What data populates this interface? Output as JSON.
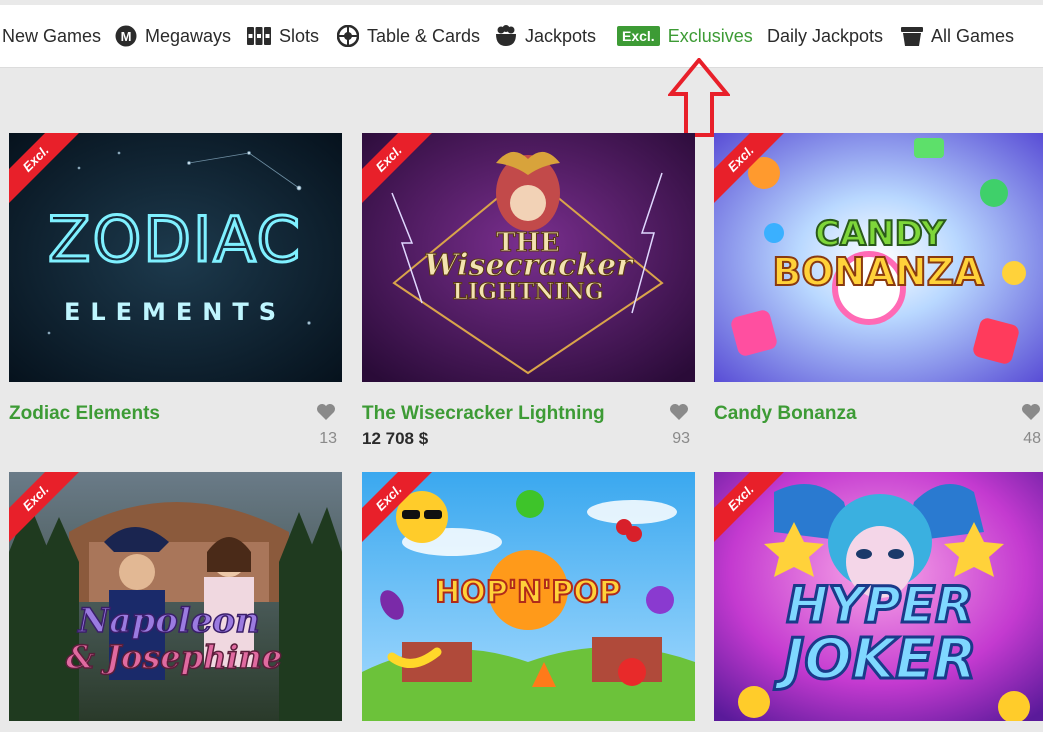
{
  "nav": {
    "items": [
      {
        "label": "New Games",
        "icon": "none"
      },
      {
        "label": "Megaways",
        "icon": "megaways-icon"
      },
      {
        "label": "Slots",
        "icon": "slots-icon"
      },
      {
        "label": "Table & Cards",
        "icon": "roulette-icon"
      },
      {
        "label": "Jackpots",
        "icon": "pot-icon"
      },
      {
        "label": "Exclusives",
        "badge": "Excl.",
        "icon": "excl-badge"
      },
      {
        "label": "Daily Jackpots",
        "icon": "none"
      },
      {
        "label": "All Games",
        "icon": "bucket-icon"
      }
    ],
    "active_index": 5
  },
  "colors": {
    "accent": "#3d9b35",
    "ribbon": "#e8202a",
    "arrow": "#e8202a"
  },
  "games": [
    {
      "title": "Zodiac Elements",
      "likes": "13",
      "jackpot": "",
      "ribbon": "Excl.",
      "art_text": [
        "ZODIAC",
        "ELEMENTS"
      ]
    },
    {
      "title": "The Wisecracker Lightning",
      "likes": "93",
      "jackpot": "12 708 $",
      "ribbon": "Excl.",
      "art_text": [
        "THE",
        "Wisecracker",
        "LIGHTNING"
      ]
    },
    {
      "title": "Candy Bonanza",
      "likes": "48",
      "jackpot": "",
      "ribbon": "Excl.",
      "art_text": [
        "CANDY",
        "BONANZA"
      ]
    },
    {
      "title": "Napoleon & Josephine",
      "likes": "",
      "jackpot": "",
      "ribbon": "Excl.",
      "art_text": [
        "Napoleon",
        "& Josephine"
      ]
    },
    {
      "title": "Hop'N'Pop",
      "likes": "",
      "jackpot": "",
      "ribbon": "Excl.",
      "art_text": [
        "HOP'N'POP"
      ]
    },
    {
      "title": "Hyper Joker",
      "likes": "",
      "jackpot": "",
      "ribbon": "Excl.",
      "art_text": [
        "HYPER",
        "JOKER"
      ]
    }
  ]
}
